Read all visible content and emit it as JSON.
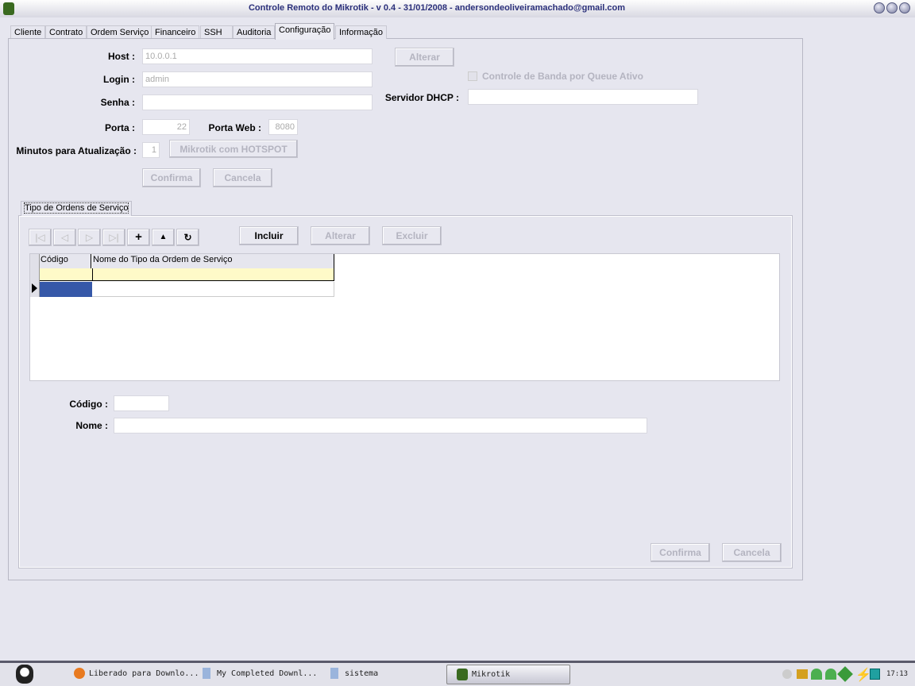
{
  "window": {
    "title": "Controle Remoto do Mikrotik - v 0.4 - 31/01/2008 - andersondeoliveiramachado@gmail.com"
  },
  "tabs": [
    {
      "label": "Cliente"
    },
    {
      "label": "Contrato"
    },
    {
      "label": "Ordem Serviço"
    },
    {
      "label": "Financeiro"
    },
    {
      "label": "SSH"
    },
    {
      "label": "Auditoria"
    },
    {
      "label": "Configuração",
      "active": true
    },
    {
      "label": "Informação"
    }
  ],
  "config": {
    "host_label": "Host :",
    "host_value": "10.0.0.1",
    "login_label": "Login :",
    "login_value": "admin",
    "senha_label": "Senha :",
    "senha_value": "",
    "porta_label": "Porta :",
    "porta_value": "22",
    "porta_web_label": "Porta Web :",
    "porta_web_value": "8080",
    "minutos_label": "Minutos para Atualização :",
    "minutos_value": "1",
    "hotspot_button": "Mikrotik com HOTSPOT",
    "alterar_button": "Alterar",
    "queue_checkbox": "Controle de Banda por Queue Ativo",
    "dhcp_label": "Servidor DHCP :",
    "dhcp_value": "",
    "confirma_button": "Confirma",
    "cancela_button": "Cancela"
  },
  "tipo_os": {
    "group_label": "Tipo de Ordens de Serviço",
    "nav": {
      "first": "|◁",
      "prev": "◁",
      "next": "▷",
      "last": "▷|",
      "insert": "+",
      "up": "▲",
      "refresh": "↻"
    },
    "incluir_button": "Incluir",
    "alterar_button": "Alterar",
    "excluir_button": "Excluir",
    "columns": [
      "Código",
      "Nome do Tipo da Ordem de Serviço"
    ],
    "codigo_label": "Código :",
    "codigo_value": "",
    "nome_label": "Nome :",
    "nome_value": "",
    "confirma_button": "Confirma",
    "cancela_button": "Cancela"
  },
  "taskbar": {
    "items": [
      {
        "label": "Liberado para Downlo..."
      },
      {
        "label": "My Completed Downl..."
      },
      {
        "label": "sistema"
      },
      {
        "label": "Mikrotik",
        "active": true
      }
    ],
    "clock": "17:13"
  }
}
